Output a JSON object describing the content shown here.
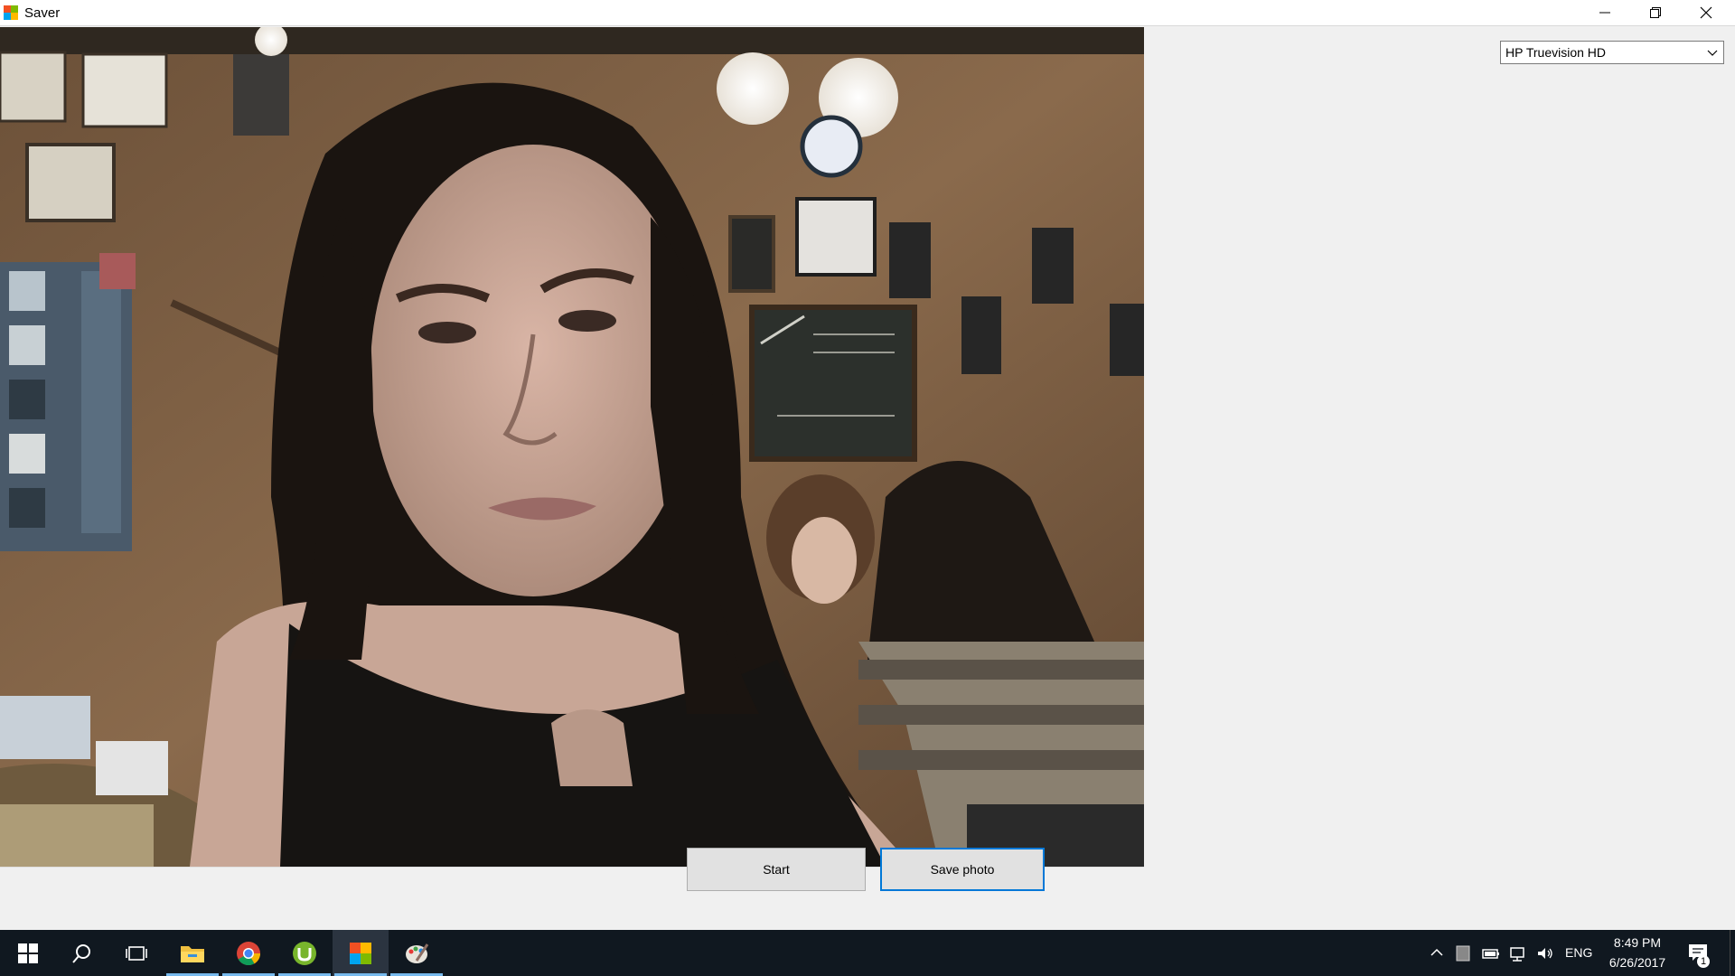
{
  "window": {
    "title": "Saver"
  },
  "device_select": {
    "selected": "HP Truevision HD"
  },
  "buttons": {
    "start_label": "Start",
    "save_label": "Save photo"
  },
  "taskbar": {
    "pinned": [
      {
        "icon": "windows-start-icon"
      },
      {
        "icon": "search-icon"
      },
      {
        "icon": "task-view-icon"
      },
      {
        "icon": "file-explorer-icon"
      },
      {
        "icon": "chrome-icon"
      },
      {
        "icon": "utorrent-icon"
      },
      {
        "icon": "saver-app-icon"
      },
      {
        "icon": "paint-icon"
      }
    ],
    "language": "ENG",
    "time": "8:49 PM",
    "date": "6/26/2017",
    "notification_count": "1"
  },
  "colors": {
    "accent": "#0078d7",
    "taskbar": "#101820"
  }
}
